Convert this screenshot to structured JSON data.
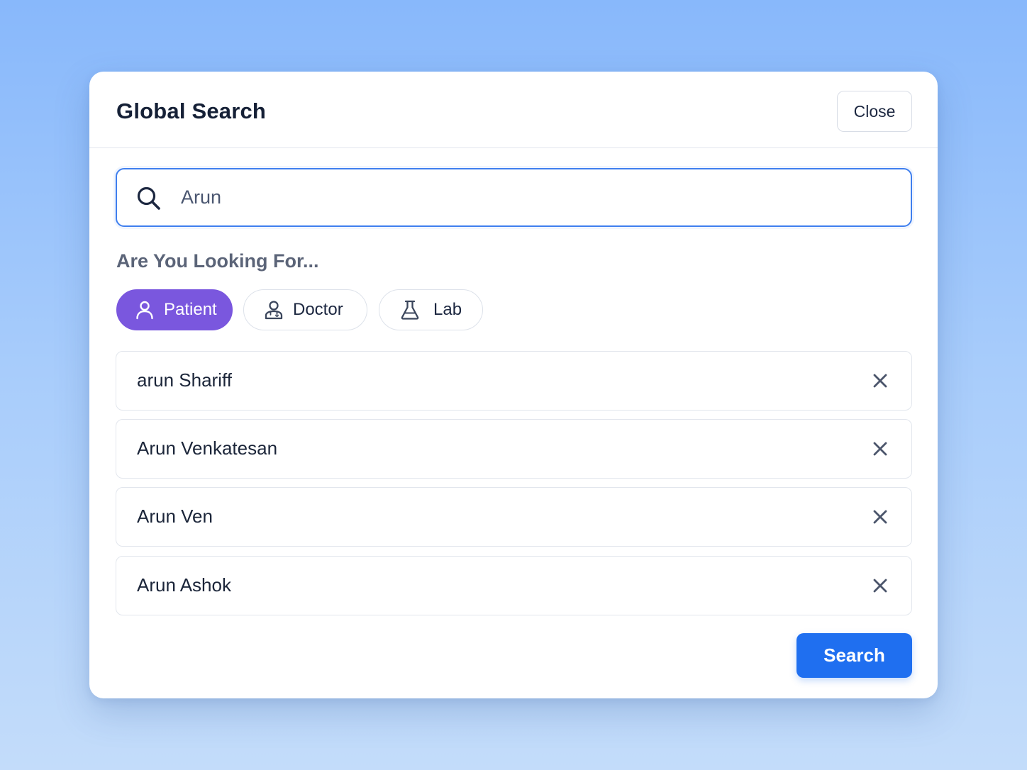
{
  "modal": {
    "title": "Global Search",
    "close_label": "Close"
  },
  "search": {
    "value": "Arun",
    "icon": "search-icon"
  },
  "filters": {
    "heading": "Are You Looking For...",
    "chips": [
      {
        "label": "Patient",
        "icon": "user-icon",
        "selected": true
      },
      {
        "label": "Doctor",
        "icon": "doctor-icon",
        "selected": false
      },
      {
        "label": "Lab",
        "icon": "flask-icon",
        "selected": false
      }
    ]
  },
  "results": [
    {
      "name": "arun Shariff"
    },
    {
      "name": "Arun Venkatesan"
    },
    {
      "name": "Arun Ven"
    },
    {
      "name": "Arun Ashok"
    }
  ],
  "actions": {
    "search_label": "Search"
  },
  "colors": {
    "accent": "#1f6ff0",
    "chip_selected": "#7a57de",
    "focus_border": "#3f7fee"
  }
}
